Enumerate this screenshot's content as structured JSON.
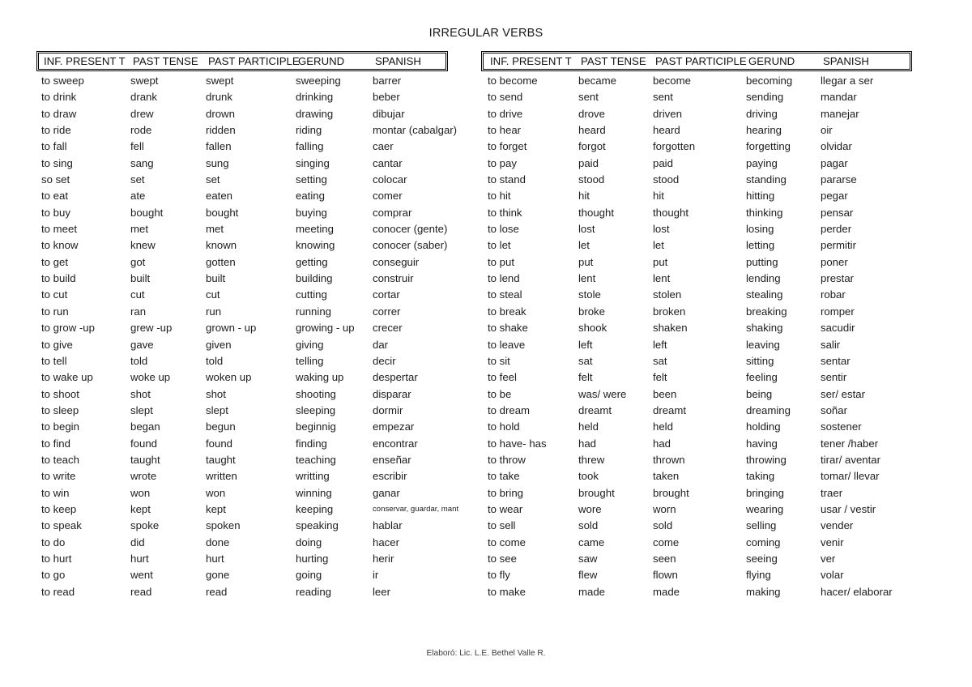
{
  "document": {
    "title": "IRREGULAR VERBS",
    "footer": "Elaboró: Lic. L.E. Bethel Valle R."
  },
  "tables": [
    {
      "id": "left-table",
      "columns": [
        "INF. PRESENT T",
        "PAST TENSE",
        "PAST PARTICIPLE",
        "GERUND",
        "SPANISH"
      ],
      "rows": [
        [
          "to sweep",
          "swept",
          "swept",
          "sweeping",
          "barrer"
        ],
        [
          "to drink",
          "drank",
          "drunk",
          "drinking",
          "beber"
        ],
        [
          "to draw",
          "drew",
          "drown",
          "drawing",
          "dibujar"
        ],
        [
          "to ride",
          "rode",
          "ridden",
          "riding",
          "montar (cabalgar)"
        ],
        [
          "to fall",
          "fell",
          "fallen",
          "falling",
          "caer"
        ],
        [
          "to sing",
          "sang",
          "sung",
          "singing",
          "cantar"
        ],
        [
          "so set",
          "set",
          "set",
          "setting",
          "colocar"
        ],
        [
          "to eat",
          "ate",
          "eaten",
          "eating",
          "comer"
        ],
        [
          "to buy",
          "bought",
          "bought",
          "buying",
          "comprar"
        ],
        [
          "to meet",
          "met",
          "met",
          "meeting",
          "conocer (gente)"
        ],
        [
          "to know",
          "knew",
          "known",
          "knowing",
          "conocer (saber)"
        ],
        [
          "to get",
          "got",
          "gotten",
          "getting",
          "conseguir"
        ],
        [
          "to build",
          "built",
          "built",
          "building",
          "construir"
        ],
        [
          "to cut",
          "cut",
          "cut",
          "cutting",
          "cortar"
        ],
        [
          "to run",
          "ran",
          "run",
          "running",
          "correr"
        ],
        [
          "to grow -up",
          "grew -up",
          "grown - up",
          "growing - up",
          "crecer"
        ],
        [
          "to give",
          "gave",
          "given",
          "giving",
          "dar"
        ],
        [
          "to tell",
          "told",
          "told",
          "telling",
          "decir"
        ],
        [
          "to wake up",
          "woke up",
          "woken up",
          "waking up",
          "despertar"
        ],
        [
          "to shoot",
          "shot",
          "shot",
          "shooting",
          "disparar"
        ],
        [
          "to sleep",
          "slept",
          "slept",
          "sleeping",
          "dormir"
        ],
        [
          "to begin",
          "began",
          "begun",
          "beginnig",
          "empezar"
        ],
        [
          "to find",
          "found",
          "found",
          "finding",
          "encontrar"
        ],
        [
          "to teach",
          "taught",
          "taught",
          "teaching",
          "enseñar"
        ],
        [
          "to write",
          "wrote",
          "written",
          "writting",
          "escribir"
        ],
        [
          "to win",
          "won",
          "won",
          "winning",
          "ganar"
        ],
        [
          "to keep",
          "kept",
          "kept",
          "keeping",
          "conservar, guardar, mant"
        ],
        [
          "to speak",
          "spoke",
          "spoken",
          "speaking",
          "hablar"
        ],
        [
          "to do",
          "did",
          "done",
          "doing",
          "hacer"
        ],
        [
          "to hurt",
          "hurt",
          "hurt",
          "hurting",
          "herir"
        ],
        [
          "to go",
          "went",
          "gone",
          "going",
          "ir"
        ],
        [
          "to read",
          "read",
          "read",
          "reading",
          "leer"
        ]
      ],
      "shrink_cells": [
        [
          26,
          4
        ]
      ]
    },
    {
      "id": "right-table",
      "columns": [
        "INF. PRESENT T",
        "PAST TENSE",
        "PAST PARTICIPLE",
        "GERUND",
        "SPANISH"
      ],
      "rows": [
        [
          "to become",
          "became",
          "become",
          "becoming",
          "llegar a ser"
        ],
        [
          "to send",
          "sent",
          "sent",
          "sending",
          "mandar"
        ],
        [
          "to drive",
          "drove",
          "driven",
          "driving",
          "manejar"
        ],
        [
          "to hear",
          "heard",
          "heard",
          "hearing",
          "oir"
        ],
        [
          "to forget",
          "forgot",
          "forgotten",
          "forgetting",
          "olvidar"
        ],
        [
          "to pay",
          "paid",
          "paid",
          "paying",
          "pagar"
        ],
        [
          "to stand",
          "stood",
          "stood",
          "standing",
          "pararse"
        ],
        [
          "to hit",
          "hit",
          "hit",
          "hitting",
          "pegar"
        ],
        [
          "to think",
          "thought",
          "thought",
          "thinking",
          "pensar"
        ],
        [
          "to lose",
          "lost",
          "lost",
          "losing",
          "perder"
        ],
        [
          "to let",
          "let",
          "let",
          "letting",
          "permitir"
        ],
        [
          "to put",
          "put",
          "put",
          "putting",
          "poner"
        ],
        [
          "to lend",
          "lent",
          "lent",
          "lending",
          "prestar"
        ],
        [
          "to steal",
          "stole",
          "stolen",
          "stealing",
          "robar"
        ],
        [
          "to break",
          "broke",
          "broken",
          "breaking",
          "romper"
        ],
        [
          "to shake",
          "shook",
          "shaken",
          "shaking",
          "sacudir"
        ],
        [
          "to leave",
          "left",
          "left",
          "leaving",
          "salir"
        ],
        [
          "to sit",
          "sat",
          "sat",
          "sitting",
          "sentar"
        ],
        [
          "to feel",
          "felt",
          "felt",
          "feeling",
          "sentir"
        ],
        [
          "to be",
          "was/ were",
          "been",
          "being",
          "ser/ estar"
        ],
        [
          "to dream",
          "dreamt",
          "dreamt",
          "dreaming",
          "soñar"
        ],
        [
          "to hold",
          "held",
          "held",
          "holding",
          "sostener"
        ],
        [
          "to have- has",
          "had",
          "had",
          "having",
          "tener /haber"
        ],
        [
          "to throw",
          "threw",
          "thrown",
          "throwing",
          "tirar/ aventar"
        ],
        [
          "to take",
          "took",
          "taken",
          "taking",
          "tomar/ llevar"
        ],
        [
          "to bring",
          "brought",
          "brought",
          "bringing",
          "traer"
        ],
        [
          "to wear",
          "wore",
          "worn",
          "wearing",
          "usar / vestir"
        ],
        [
          "to sell",
          "sold",
          "sold",
          "selling",
          "vender"
        ],
        [
          "to come",
          "came",
          "come",
          "coming",
          "venir"
        ],
        [
          "to see",
          "saw",
          "seen",
          "seeing",
          "ver"
        ],
        [
          "to fly",
          "flew",
          "flown",
          "flying",
          "volar"
        ],
        [
          "to make",
          "made",
          "made",
          "making",
          "hacer/ elaborar"
        ]
      ],
      "shrink_cells": []
    }
  ],
  "colors": {
    "page_background": "#ffffff",
    "text": "#1d1d1d",
    "border": "#000000"
  }
}
